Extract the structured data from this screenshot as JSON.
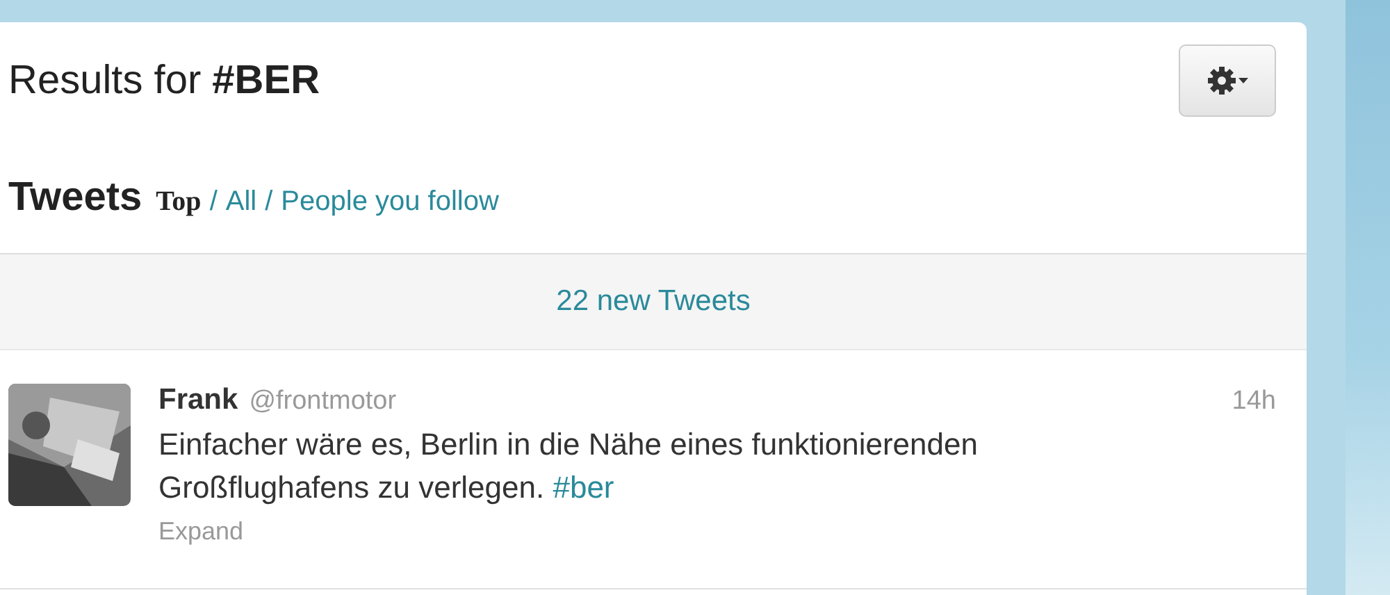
{
  "header": {
    "title": "Results for **#BER**"
  },
  "tweets_header": {
    "title": "Tweets",
    "separator": "/",
    "filters": [
      {
        "label": "Top",
        "selected": true
      },
      {
        "label": "All",
        "selected": false
      },
      {
        "label": "People you follow",
        "selected": false
      }
    ]
  },
  "new_tweets": "22 new Tweets",
  "tweets": [
    {
      "name": "Frank",
      "handle": "@frontmotor",
      "time": "14h",
      "text": "Einfacher wäre es, Berlin in die Nähe eines funktionierenden Großflughafens zu verlegen.",
      "hashtag": "#ber",
      "expand": "Expand"
    }
  ]
}
